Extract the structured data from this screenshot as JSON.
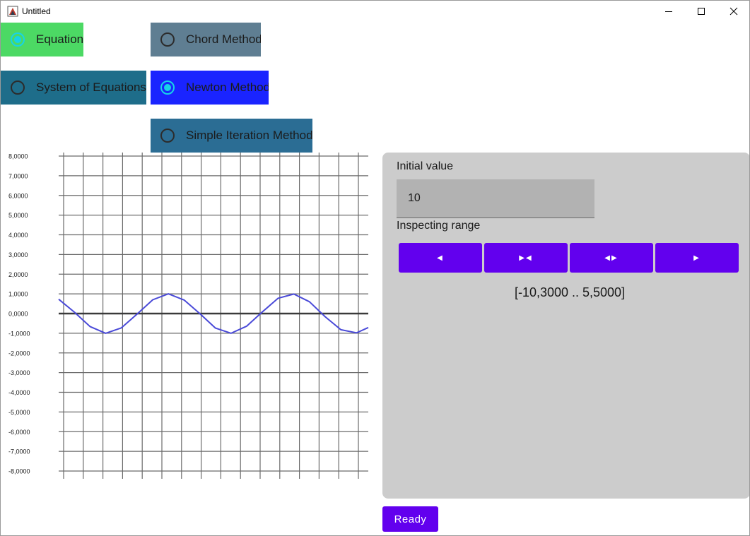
{
  "window": {
    "title": "Untitled"
  },
  "methods": {
    "equation": {
      "label": "Equation",
      "checked": true,
      "color": "#4cd964"
    },
    "system": {
      "label": "System of Equations",
      "checked": false,
      "color": "#1e6d8a"
    },
    "chord": {
      "label": "Chord Method",
      "checked": false,
      "color": "#5f7e92"
    },
    "newton": {
      "label": "Newton Method",
      "checked": true,
      "color": "#1a24ff"
    },
    "simple_iteration": {
      "label": "Simple Iteration Method",
      "checked": false,
      "color": "#2b6d94"
    }
  },
  "panel": {
    "initial_value_label": "Initial value",
    "initial_value": "10",
    "range_label": "Inspecting range",
    "buttons": [
      {
        "name": "shift-left",
        "label": "◀"
      },
      {
        "name": "narrow",
        "label": "▶◀"
      },
      {
        "name": "widen",
        "label": "◀▶"
      },
      {
        "name": "shift-right",
        "label": "▶"
      }
    ],
    "range_text": "[-10,3000 .. 5,5000]"
  },
  "ready_label": "Ready",
  "colors": {
    "accent": "#6200ee",
    "radio_checked": "#17d4e6",
    "panel_bg": "#cccccc",
    "curve": "#4a4ad8"
  },
  "chart_data": {
    "type": "line",
    "x_range": [
      -10.3,
      5.5
    ],
    "ylim": [
      -8,
      8
    ],
    "y_ticks": [
      "8,0000",
      "7,0000",
      "6,0000",
      "5,0000",
      "4,0000",
      "3,0000",
      "2,0000",
      "1,0000",
      "0,0000",
      "-1,0000",
      "-2,0000",
      "-3,0000",
      "-4,0000",
      "-5,0000",
      "-6,0000",
      "-7,0000",
      "-8,0000"
    ],
    "grid": true,
    "series": [
      {
        "x": [
          -10.3,
          -9.5,
          -8.7,
          -7.9,
          -7.1,
          -6.3,
          -5.5,
          -4.7,
          -3.9,
          -3.1,
          -2.3,
          -1.5,
          -0.7,
          0.1,
          0.9,
          1.7,
          2.5,
          3.3,
          4.1,
          4.9,
          5.5
        ],
        "y": [
          0.73,
          0.07,
          -0.66,
          -1.0,
          -0.73,
          -0.03,
          0.7,
          1.0,
          0.69,
          0.0,
          -0.74,
          -1.0,
          -0.64,
          0.09,
          0.78,
          0.99,
          0.6,
          -0.16,
          -0.82,
          -0.98,
          -0.71
        ]
      }
    ]
  }
}
